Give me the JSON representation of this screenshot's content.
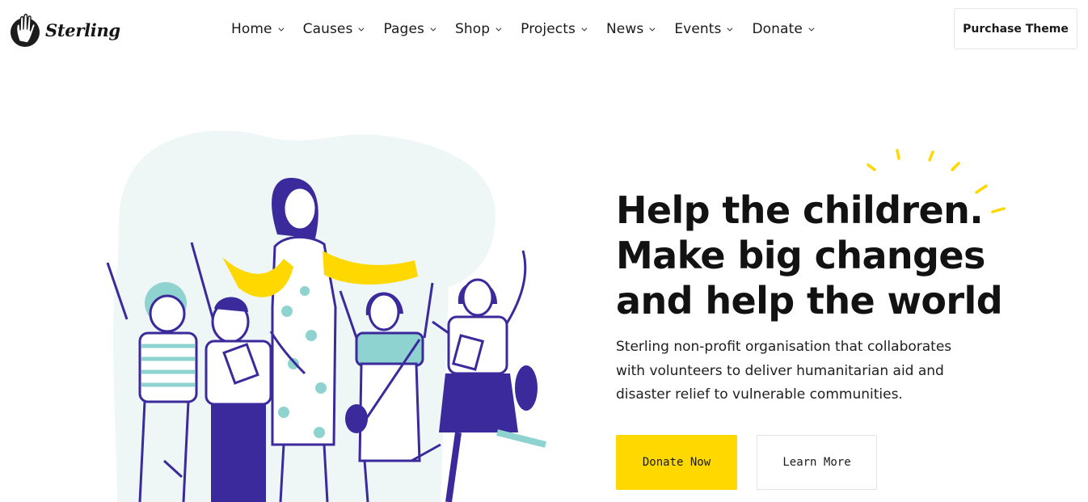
{
  "brand": {
    "name": "Sterling",
    "logo_icon": "hand-icon"
  },
  "nav": {
    "items": [
      {
        "label": "Home"
      },
      {
        "label": "Causes"
      },
      {
        "label": "Pages"
      },
      {
        "label": "Shop"
      },
      {
        "label": "Projects"
      },
      {
        "label": "News"
      },
      {
        "label": "Events"
      },
      {
        "label": "Donate"
      }
    ],
    "caret_icon": "chevron-down-icon"
  },
  "header": {
    "purchase_label": "Purchase Theme"
  },
  "hero": {
    "title_lines": [
      "Help the children.",
      "Make big changes",
      "and help the world"
    ],
    "description": "Sterling non-profit organisation that collaborates with volunteers to deliver humanitarian aid and disaster relief to vulnerable communities.",
    "primary_button": "Donate Now",
    "secondary_button": "Learn More",
    "illustration": "children-with-teacher-illustration",
    "decoration": "sun-rays-icon"
  },
  "colors": {
    "accent_yellow": "#ffd800",
    "illustration_purple": "#3b2a9c",
    "illustration_teal": "#8fd3d0",
    "blob": "#eef6f6",
    "text_dark": "#121212"
  }
}
